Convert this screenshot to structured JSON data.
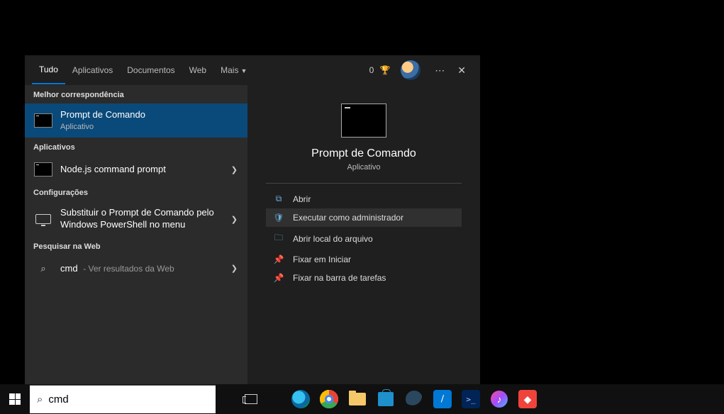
{
  "tabs": {
    "all": "Tudo",
    "apps": "Aplicativos",
    "docs": "Documentos",
    "web": "Web",
    "more": "Mais"
  },
  "header": {
    "reward_count": "0"
  },
  "left": {
    "best_match_header": "Melhor correspondência",
    "best_match": {
      "title": "Prompt de Comando",
      "sub": "Aplicativo"
    },
    "apps_header": "Aplicativos",
    "app1": {
      "title": "Node.js command prompt"
    },
    "settings_header": "Configurações",
    "setting1": {
      "title": "Substituir o Prompt de Comando pelo Windows PowerShell no menu"
    },
    "web_header": "Pesquisar na Web",
    "web1": {
      "title": "cmd",
      "sub": "- Ver resultados da Web"
    }
  },
  "preview": {
    "title": "Prompt de Comando",
    "sub": "Aplicativo",
    "actions": {
      "open": "Abrir",
      "run_admin": "Executar como administrador",
      "open_location": "Abrir local do arquivo",
      "pin_start": "Fixar em Iniciar",
      "pin_taskbar": "Fixar na barra de tarefas"
    }
  },
  "search": {
    "value": "cmd"
  }
}
